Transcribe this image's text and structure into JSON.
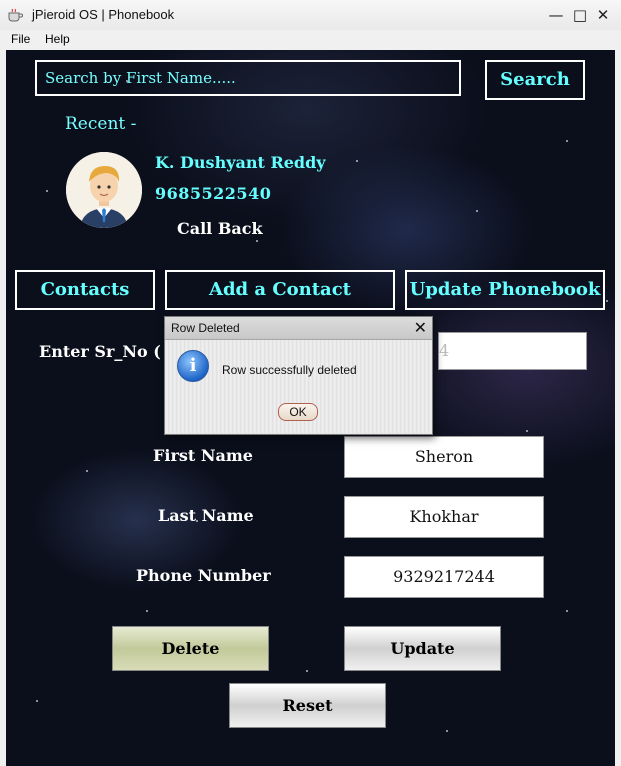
{
  "window": {
    "title": "jPieroid OS | Phonebook",
    "minimize": "—",
    "maximize": "□",
    "close": "✕"
  },
  "menu": [
    "File",
    "Help"
  ],
  "search": {
    "placeholder": "Search by First Name.....",
    "button": "Search"
  },
  "recent": {
    "heading": "Recent -",
    "name": "K. Dushyant Reddy",
    "phone": "9685522540",
    "call_back": "Call Back"
  },
  "nav": [
    "Contacts",
    "Add a Contact",
    "Update Phonebook"
  ],
  "form": {
    "srno_label": "Enter Sr_No  (",
    "srno_value": "4",
    "first_name_label": "First Name",
    "first_name_value": "Sheron",
    "last_name_label": "Last Name",
    "last_name_value": "Khokhar",
    "phone_label": "Phone Number",
    "phone_value": "9329217244"
  },
  "buttons": {
    "delete": "Delete",
    "update": "Update",
    "reset": "Reset"
  },
  "dialog": {
    "title": "Row Deleted",
    "close": "✕",
    "icon": "i",
    "message": "Row successfully deleted",
    "ok": "OK"
  },
  "colors": {
    "accent": "#66ffff",
    "panel_bg": "#0b0f1c",
    "delete_button": "#c2c99a"
  }
}
